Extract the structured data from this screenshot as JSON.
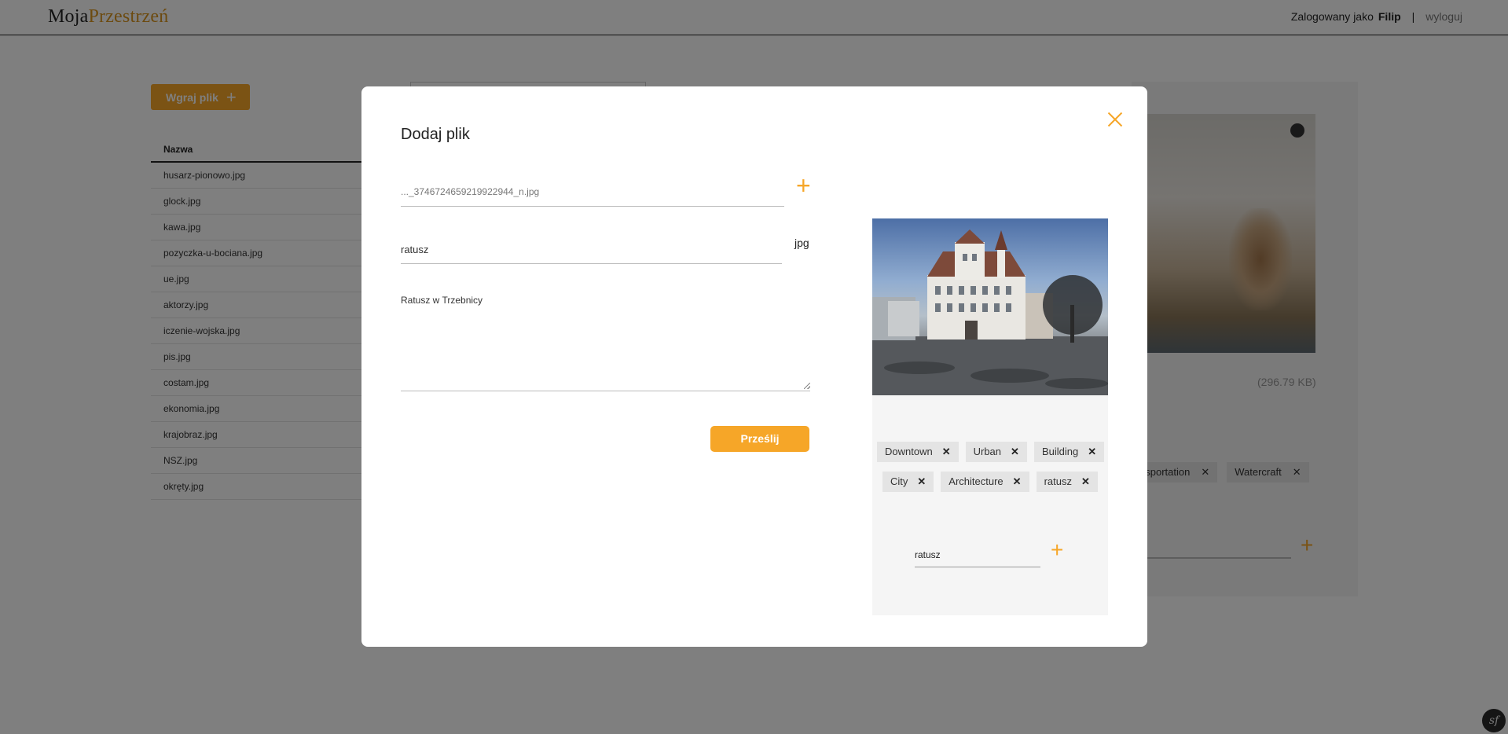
{
  "header": {
    "logo_part1": "Moja",
    "logo_part2": "Przestrzeń",
    "logged_as": "Zalogowany jako",
    "username": "Filip",
    "separator": "|",
    "logout": "wyloguj"
  },
  "background": {
    "upload_label": "Wgraj plik",
    "table_header": "Nazwa",
    "files": [
      "husarz-pionowo.jpg",
      "glock.jpg",
      "kawa.jpg",
      "pozyczka-u-bociana.jpg",
      "ue.jpg",
      "aktorzy.jpg",
      "iczenie-wojska.jpg",
      "pis.jpg",
      "costam.jpg",
      "ekonomia.jpg",
      "krajobraz.jpg",
      "NSZ.jpg",
      "okręty.jpg"
    ],
    "file_size": "(296.79 KB)",
    "tags": [
      "nsportation",
      "Watercraft"
    ]
  },
  "modal": {
    "title": "Dodaj plik",
    "file_path": "..._3746724659219922944_n.jpg",
    "name_value": "ratusz",
    "extension": "jpg",
    "description": "Ratusz w Trzebnicy",
    "submit_label": "Prześlij",
    "tags": [
      "Downtown",
      "Urban",
      "Building",
      "City",
      "Architecture",
      "ratusz"
    ],
    "tag_input_value": "ratusz",
    "remove_symbol": "✕",
    "plus_symbol": "+"
  },
  "colors": {
    "accent": "#f6a628",
    "overlay": "rgba(0,0,0,0.5)"
  }
}
